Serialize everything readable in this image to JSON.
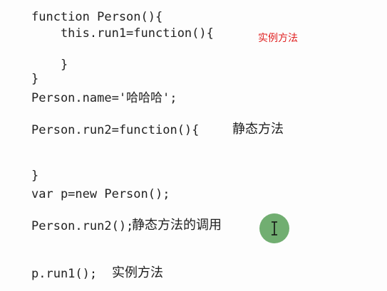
{
  "code": {
    "line1": "function Person(){",
    "line2": "    this.run1=function(){",
    "line3": "    }",
    "line4": "}",
    "line5": "Person.name='哈哈哈';",
    "line6": "Person.run2=function(){",
    "line7": "}",
    "line8": "var p=new Person();",
    "line9": "Person.run2();",
    "line10": "p.run1();"
  },
  "notes": {
    "instance_method_red": "实例方法",
    "static_method": "静态方法",
    "static_method_call": "静态方法的调用",
    "instance_method": "实例方法"
  },
  "icons": {
    "cursor": "text-cursor-icon"
  },
  "colors": {
    "red_note": "#e02020",
    "cursor_circle": "#58a058"
  }
}
